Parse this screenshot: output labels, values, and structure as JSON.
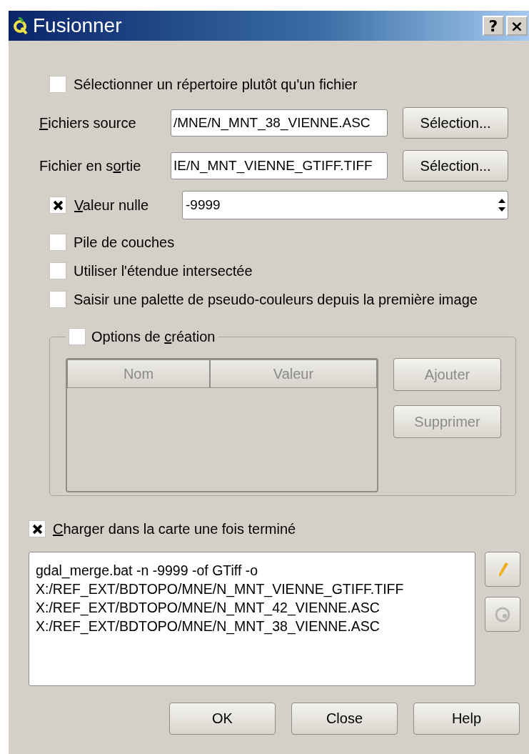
{
  "window": {
    "title": "Fusionner",
    "help_button": "?",
    "close_button": "×"
  },
  "dir_option": {
    "label": "Sélectionner un répertoire plutôt qu'un fichier",
    "checked": false
  },
  "files": [
    {
      "label": {
        "key": "F",
        "post": "ichiers source"
      },
      "value": "/MNE/N_MNT_38_VIENNE.ASC",
      "button": "Sélection..."
    },
    {
      "label": {
        "pre": "Fichier en s",
        "key": "o",
        "post": "rtie"
      },
      "value": "IE/N_MNT_VIENNE_GTIFF.TIFF",
      "button": "Sélection..."
    }
  ],
  "nodata": {
    "label": {
      "key": "V",
      "post": "aleur nulle"
    },
    "checked": true,
    "value": "-9999"
  },
  "options": [
    {
      "label": "Pile de couches",
      "checked": false
    },
    {
      "label": "Utiliser l'étendue intersectée",
      "checked": false
    },
    {
      "label": "Saisir une palette de pseudo-couleurs depuis la première image",
      "checked": false
    }
  ],
  "creation_group": {
    "label": {
      "pre": "Options de ",
      "key": "c",
      "post": "réation"
    },
    "checked": false,
    "columns": [
      "Nom",
      "Valeur"
    ],
    "buttons": [
      {
        "label": "Ajouter",
        "disabled": true
      },
      {
        "label": "Supprimer",
        "disabled": true
      }
    ],
    "disabled": true
  },
  "load_option": {
    "label": {
      "key": "C",
      "post": "harger dans la carte une fois terminé"
    },
    "checked": true
  },
  "command": {
    "lines": [
      "gdal_merge.bat -n -9999 -of GTiff -o",
      "X:/REF_EXT/BDTOPO/MNE/N_MNT_VIENNE_GTIFF.TIFF",
      "X:/REF_EXT/BDTOPO/MNE/N_MNT_42_VIENNE.ASC",
      "X:/REF_EXT/BDTOPO/MNE/N_MNT_38_VIENNE.ASC"
    ],
    "edit_disabled": false,
    "reset_disabled": true
  },
  "buttons": [
    "OK",
    "Close",
    "Help"
  ]
}
